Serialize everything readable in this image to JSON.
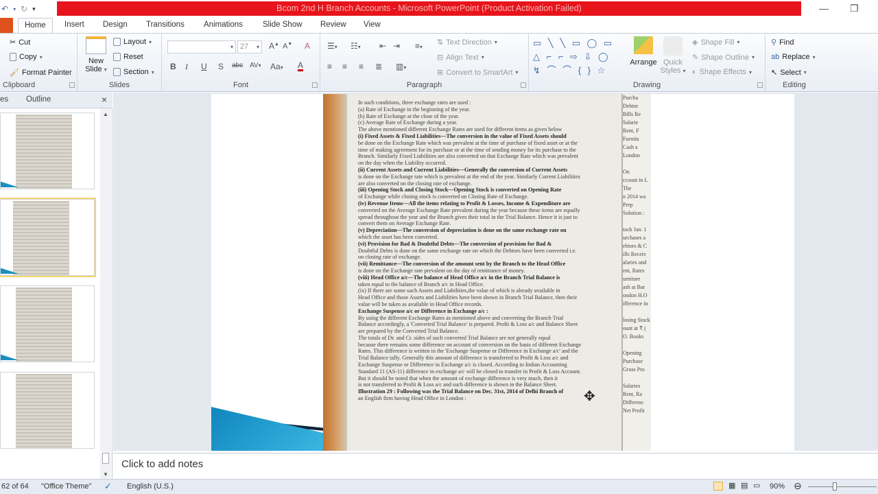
{
  "window": {
    "title": "Bcom 2nd H Branch Accounts - Microsoft PowerPoint (Product Activation Failed)",
    "accent": "#e8141b"
  },
  "qat": {
    "icons": [
      "undo-icon",
      "redo-icon",
      "customize-icon"
    ]
  },
  "tabs": [
    "Home",
    "Insert",
    "Design",
    "Transitions",
    "Animations",
    "Slide Show",
    "Review",
    "View"
  ],
  "ribbon": {
    "clipboard": {
      "label": "Clipboard",
      "cut": "Cut",
      "copy": "Copy",
      "format_painter": "Format Painter"
    },
    "slides": {
      "label": "Slides",
      "new_slide_1": "New",
      "new_slide_2": "Slide",
      "layout": "Layout",
      "reset": "Reset",
      "section": "Section"
    },
    "font": {
      "label": "Font",
      "size": "27"
    },
    "paragraph": {
      "label": "Paragraph",
      "text_direction": "Text Direction",
      "align_text": "Align Text",
      "smartart": "Convert to SmartArt"
    },
    "drawing": {
      "label": "Drawing",
      "arrange": "Arrange",
      "quick_styles_1": "Quick",
      "quick_styles_2": "Styles",
      "shape_fill": "Shape Fill",
      "shape_outline": "Shape Outline",
      "shape_effects": "Shape Effects"
    },
    "editing": {
      "label": "Editing",
      "find": "Find",
      "replace": "Replace",
      "select": "Select"
    }
  },
  "pane": {
    "tab_slides": "es",
    "tab_outline": "Outline"
  },
  "photo": {
    "lines": [
      "In such conditions, three exchange rates are used :",
      "(a) Rate of Exchange in the beginning of the year.",
      "(b) Rate of Exchange at the close of the year.",
      "(c) Average Rate of Exchange during a year.",
      "The above mentioned different Exchange Rates are used for different items as given below",
      "(i) Fixed Assets & Fixed Liabilities—The conversion in the value of Fixed Assets should",
      "be done on the Exchange Rate which was prevalent at the time of purchase of fixed asset or at the",
      "time of making agreement for its purchase or at the time of sending money for its purchase to the",
      "Branch. Similarly Fixed Liabilities are also converted on that Exchange Rate which was prevalent",
      "on the day when the Liability occurred.",
      "(ii) Current Assets and Current Liabilities—Generally the conversion of Current Assets",
      "is done on the Exchange rate which is prevalent at the end of the year. Similarly Current Liabilities",
      "are also converted on the closing rate of exchange.",
      "(iii) Opening Stock and Closing Stock—Opening Stock is converted on Opening Rate",
      "of Exchange while closing stock is converted on Closing Rate of Exchange.",
      "(iv) Revenue Items—All the items relating to Profit & Losses, Income & Expenditure are",
      "converted on the Average Exchange Rate prevalent during the year because these items are equally",
      "spread throughout the year and the Branch gives their total in the Trial Balance. Hence it is just to",
      "convert them on Average Exchange Rate.",
      "(v) Depreciation—The conversion of depreciation is done on the same exchange rate on",
      "which the asset has been converted.",
      "(vi) Provision for Bad & Doubtful Debts—The conversion of provision for Bad &",
      "Doubtful Debts is done on the same exchange rate on which the Debtors have been converted i.e.",
      "on closing rate of exchange.",
      "(vii) Remittance—The conversion of the amount sent by the Branch to the Head Office",
      "is done on the Exchange rate prevalent on the day of remittance of money.",
      "(viii) Head Office a/c—The balance of Head Office a/c in the Branch Trial Balance is",
      "taken equal to the balance of Branch a/c in Head Office.",
      "(ix) If there are some such Assets and Liabilities,the value of which is already available in",
      "Head Office and those Assets and Liabilities have been shown in Branch Trial Balance, then their",
      "value will be taken as available in Head Office records.",
      "Exchange Suspense a/c or Difference in Exchange a/c :",
      "By using the different Exchange Rates as mentioned above and converting the Branch Trial",
      "Balance accordingly, a 'Converted Trial Balance' is prepared. Profit & Loss a/c and Balance Sheet",
      "are prepared by the Converted Trial Balance.",
      "The totals of Dr. and Cr. sides of such converted Trial Balance are not generally equal",
      "because there remains some difference on account of conversion on the basis of different Exchange",
      "Rates. This difference is written in the 'Exchange Suspense or Difference in Exchange a/c' and the",
      "Trial Balance tally. Generally this amount of difference is transferred to Profit & Loss a/c and",
      "Exchange Suspense or Difference in Exchange a/c is closed. According to Indian Accounting",
      "Standard 11 (AS-11) difference in exchange a/c will be closed to transfer in Profit & Loss Account.",
      "But it should be noted that when the amount of exchange difference is very much, then it",
      "is not transferred to Profit & Loss a/c and such difference is shown in the Balance Sheet.",
      "Illustration 29 : Following was the Trial Balance on Dec. 31st, 2014 of Delhi Branch of",
      "an English firm having Head Office in London :"
    ],
    "right_lines": [
      "Purcha",
      "Debtor",
      "Bills Re",
      "Salarie",
      "Rent, F",
      "Furnitu",
      "Cash a",
      "London",
      "",
      "On",
      "ccount in L",
      "The",
      "n 2014 wa",
      "Prep",
      "Solution :",
      "",
      "tock Jan. 1",
      "urchases a",
      "ebtors & C",
      "ills Receiv",
      "alaries and",
      "ent, Rates",
      "urniture",
      "ash at Bar",
      "ondon H.O",
      "ifference in",
      "",
      "losing Stock",
      "ount at ₹ (",
      "O. Books",
      "",
      "Opening",
      "Purchase",
      "Gross Pro",
      "",
      "Salaries",
      "Rent, Ra",
      "Differenc",
      "Net Profit"
    ]
  },
  "notes": {
    "placeholder": "Click to add notes"
  },
  "status": {
    "slide_info": "62 of 64",
    "theme": "\"Office Theme\"",
    "language": "English (U.S.)",
    "zoom": "90%"
  }
}
